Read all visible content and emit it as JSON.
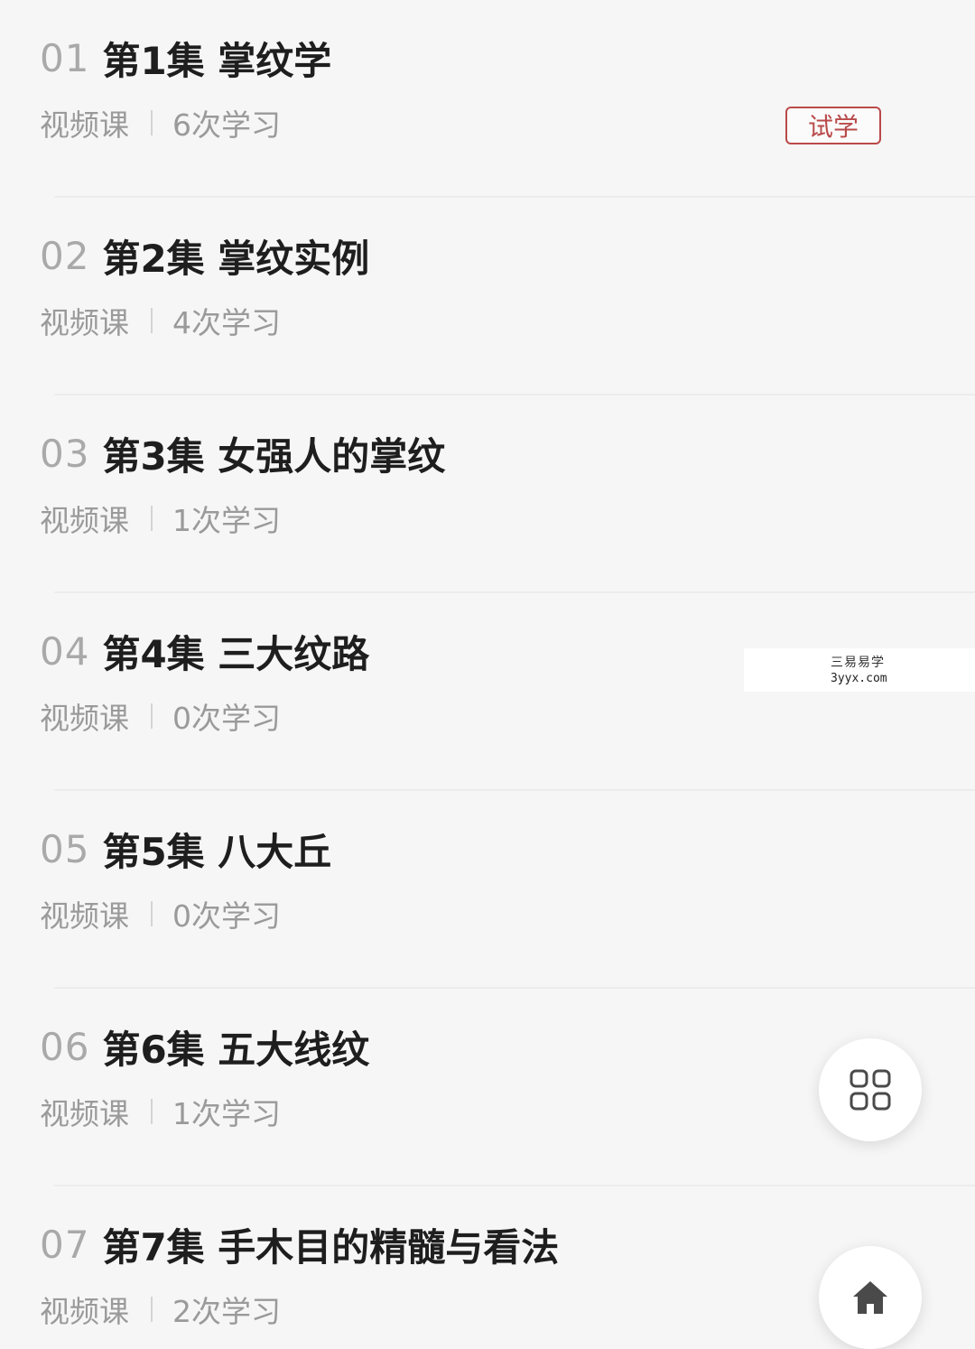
{
  "episodes": [
    {
      "num": "01",
      "title": "第1集 掌纹学",
      "type": "视频课",
      "views": "6次学习",
      "badge": "试学"
    },
    {
      "num": "02",
      "title": "第2集 掌纹实例",
      "type": "视频课",
      "views": "4次学习"
    },
    {
      "num": "03",
      "title": "第3集 女强人的掌纹",
      "type": "视频课",
      "views": "1次学习"
    },
    {
      "num": "04",
      "title": "第4集 三大纹路",
      "type": "视频课",
      "views": "0次学习"
    },
    {
      "num": "05",
      "title": "第5集 八大丘",
      "type": "视频课",
      "views": "0次学习"
    },
    {
      "num": "06",
      "title": "第6集 五大线纹",
      "type": "视频课",
      "views": "1次学习"
    },
    {
      "num": "07",
      "title": "第7集 手木目的精髓与看法",
      "type": "视频课",
      "views": "2次学习"
    }
  ],
  "watermark": {
    "line1": "三易易学",
    "line2": "3yyx.com"
  },
  "fabs": {
    "grid_icon": "grid-icon",
    "home_icon": "home-icon"
  },
  "colors": {
    "badge": "#b94a4a",
    "title": "#1e1e1e",
    "meta": "#9a9a9a",
    "number": "#a9a9a9",
    "background": "#f6f6f6"
  }
}
